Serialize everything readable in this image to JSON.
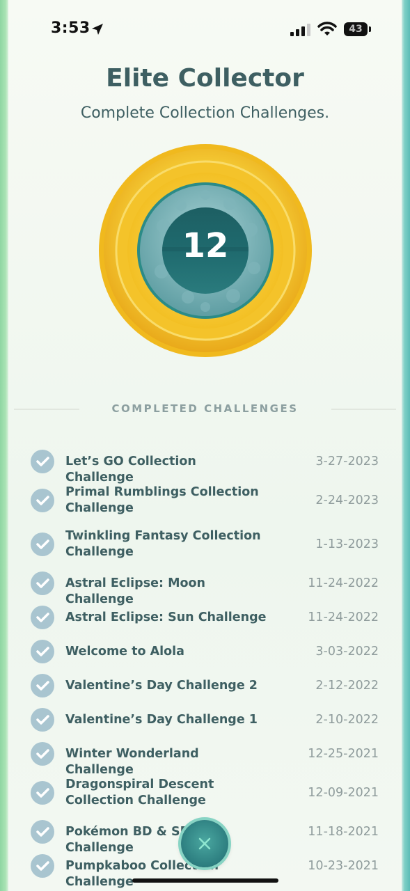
{
  "status_bar": {
    "time": "3:53",
    "battery": "43",
    "icons": [
      "location-arrow-icon",
      "cellular-signal-icon",
      "wifi-icon",
      "battery-icon"
    ]
  },
  "header": {
    "title": "Elite Collector",
    "subtitle": "Complete Collection Challenges."
  },
  "medal": {
    "count": "12",
    "ring_color": "#f5c823",
    "inner_color": "#1f6a6e"
  },
  "section": {
    "title": "COMPLETED CHALLENGES"
  },
  "challenges": [
    {
      "name": "Let’s GO Collection Challenge",
      "date": "3-27-2023"
    },
    {
      "name": "Primal Rumblings Collection Challenge",
      "date": "2-24-2023"
    },
    {
      "name": "Twinkling Fantasy Collection Challenge",
      "date": "1-13-2023"
    },
    {
      "name": "Astral Eclipse: Moon Challenge",
      "date": "11-24-2022"
    },
    {
      "name": "Astral Eclipse: Sun Challenge",
      "date": "11-24-2022"
    },
    {
      "name": "Welcome to Alola",
      "date": "3-03-2022"
    },
    {
      "name": "Valentine’s Day Challenge 2",
      "date": "2-12-2022"
    },
    {
      "name": "Valentine’s Day Challenge 1",
      "date": "2-10-2022"
    },
    {
      "name": "Winter Wonderland Challenge",
      "date": "12-25-2021"
    },
    {
      "name": "Dragonspiral Descent Collection Challenge",
      "date": "12-09-2021"
    },
    {
      "name": "Pokémon BD & SP Ex Challenge",
      "date": "11-18-2021"
    },
    {
      "name": "Pumpkaboo Collection Challenge",
      "date": "10-23-2021"
    }
  ],
  "close_button": {
    "icon": "close-icon"
  },
  "colors": {
    "text_primary": "#3e5f62",
    "text_muted": "#8f9c9c",
    "check_circle": "#a9c5d0",
    "fab": "#2c7d7f"
  }
}
